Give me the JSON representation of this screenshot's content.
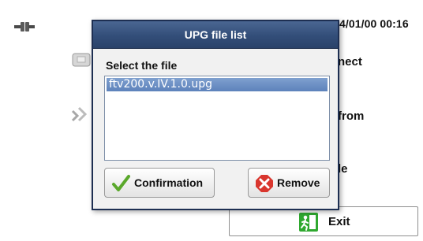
{
  "background": {
    "datetime": "4/01/00 00:16",
    "menu_labels": [
      "nect",
      "from",
      "le"
    ],
    "exit_label": "Exit"
  },
  "dialog": {
    "title": "UPG file list",
    "select_label": "Select the file",
    "files": [
      "ftv200.v.IV.1.0.upg"
    ],
    "selected_index": 0,
    "confirm_label": "Confirmation",
    "remove_label": "Remove"
  },
  "icons": {
    "connection": "connection-icon",
    "menu_item_1": "connect-icon",
    "menu_item_2": "transfer-icon",
    "exit": "exit-icon",
    "confirm": "checkmark-icon",
    "remove": "remove-icon"
  },
  "colors": {
    "titlebar": "#334e79",
    "selection": "#6a8dc4",
    "exit_icon": "#2fa82f",
    "remove_icon": "#d9362e",
    "confirm_icon": "#5aa82b"
  }
}
